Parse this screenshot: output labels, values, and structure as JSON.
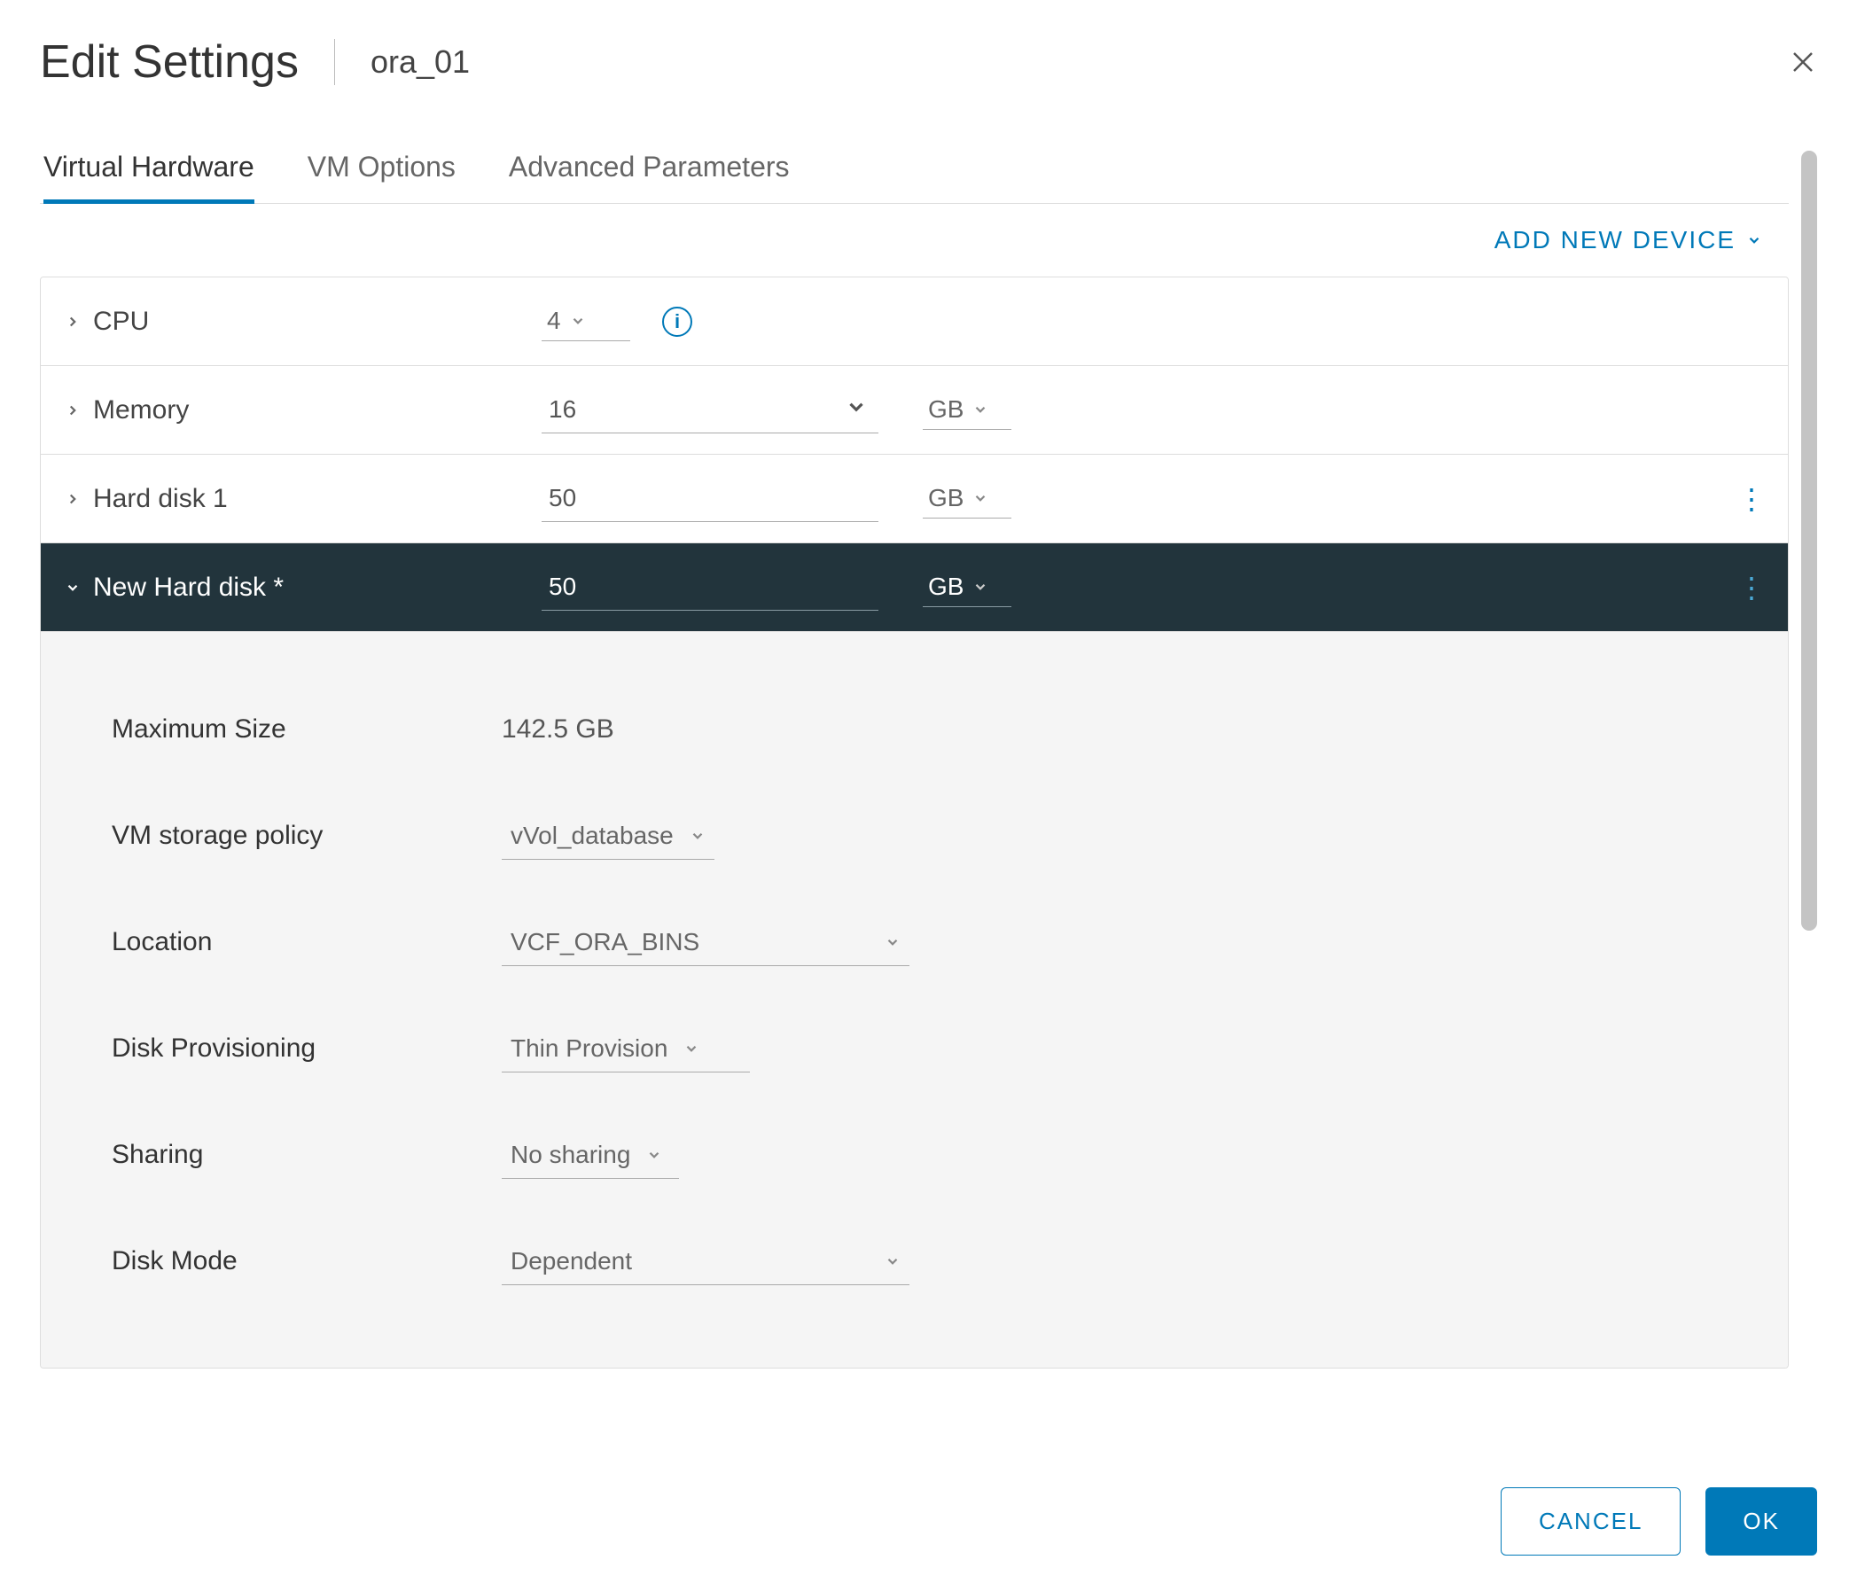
{
  "header": {
    "title": "Edit Settings",
    "vm_name": "ora_01"
  },
  "tabs": [
    {
      "label": "Virtual Hardware",
      "active": true
    },
    {
      "label": "VM Options",
      "active": false
    },
    {
      "label": "Advanced Parameters",
      "active": false
    }
  ],
  "actions": {
    "add_device": "ADD NEW DEVICE"
  },
  "hardware": {
    "cpu": {
      "label": "CPU",
      "value": "4"
    },
    "memory": {
      "label": "Memory",
      "value": "16",
      "unit": "GB"
    },
    "hard_disk_1": {
      "label": "Hard disk 1",
      "value": "50",
      "unit": "GB"
    },
    "new_hard_disk": {
      "label": "New Hard disk *",
      "value": "50",
      "unit": "GB",
      "details": {
        "max_size": {
          "label": "Maximum Size",
          "value": "142.5 GB"
        },
        "storage_policy": {
          "label": "VM storage policy",
          "value": "vVol_database"
        },
        "location": {
          "label": "Location",
          "value": "VCF_ORA_BINS"
        },
        "provisioning": {
          "label": "Disk Provisioning",
          "value": "Thin Provision"
        },
        "sharing": {
          "label": "Sharing",
          "value": "No sharing"
        },
        "disk_mode": {
          "label": "Disk Mode",
          "value": "Dependent"
        }
      }
    }
  },
  "footer": {
    "cancel": "CANCEL",
    "ok": "OK"
  }
}
